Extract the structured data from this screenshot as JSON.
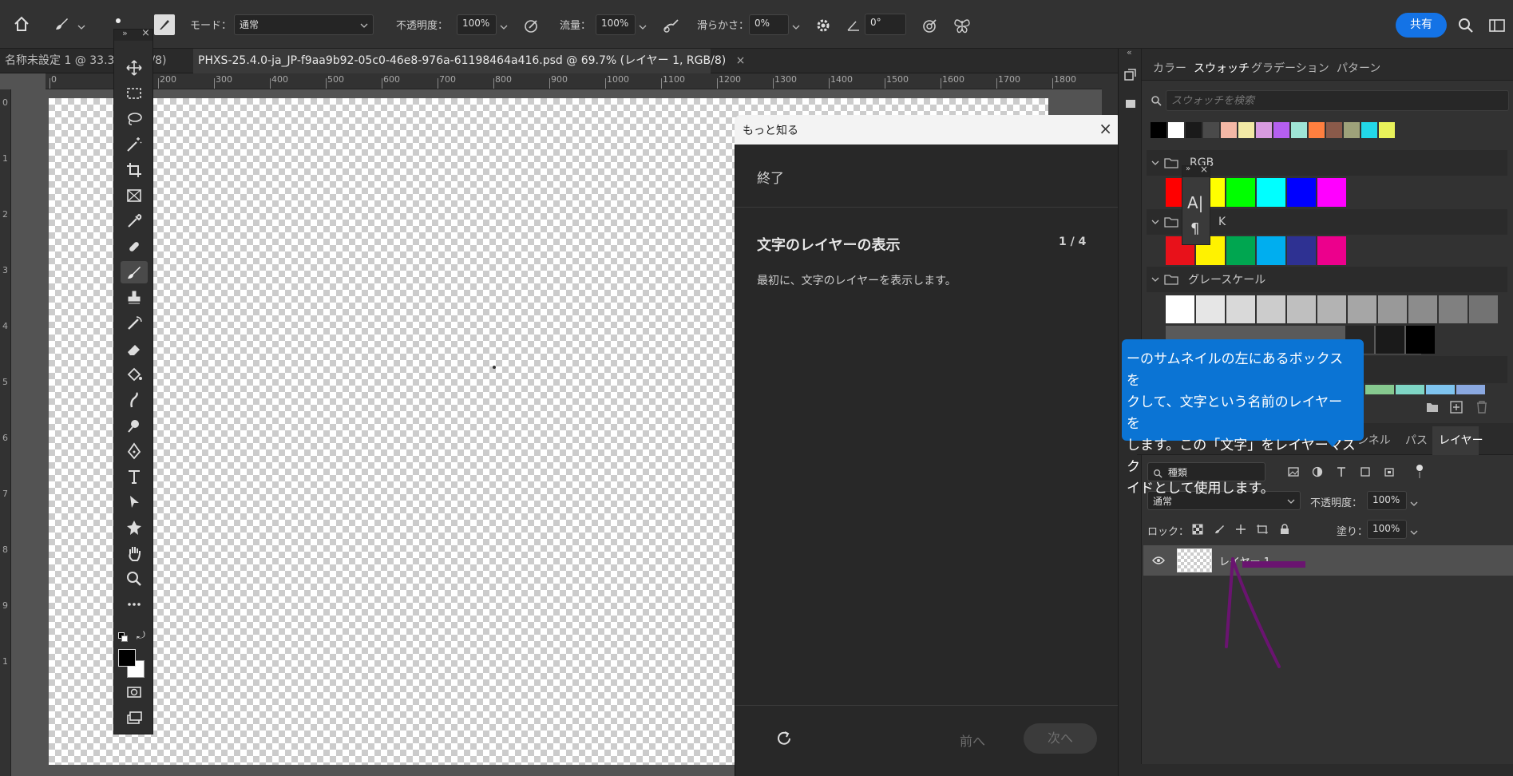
{
  "optionsBar": {
    "mode_label": "モード：",
    "mode_value": "通常",
    "opacity_label": "不透明度：",
    "opacity_value": "100%",
    "flow_label": "流量：",
    "flow_value": "100%",
    "smoothing_label": "滑らかさ：",
    "smoothing_value": "0%",
    "angle_value": "0°",
    "share_label": "共有"
  },
  "tabs": [
    {
      "label": "名称未設定 1 @ 33.3",
      "suffix": "/8)"
    },
    {
      "label": "PHXS-25.4.0-ja_JP-f9aa9b92-05c0-46e8-976a-61198464a416.psd @ 69.7% (レイヤー 1, RGB/8)",
      "close": "×"
    }
  ],
  "ruler": {
    "h_labels": [
      "0",
      "200",
      "300",
      "400",
      "500",
      "600",
      "700",
      "800",
      "900",
      "1000",
      "1100",
      "1200",
      "1300",
      "1400",
      "1500",
      "1600",
      "1700",
      "1800"
    ],
    "v_labels": [
      "0",
      "1",
      "2",
      "3",
      "4",
      "5",
      "6",
      "7",
      "8",
      "9",
      "1"
    ]
  },
  "learn": {
    "header": "もっと知る",
    "close": "×",
    "end_label": "終了",
    "step_title": "文字のレイヤーの表示",
    "step_counter": "1 / 4",
    "step_text": "最初に、文字のレイヤーを表示します。",
    "prev_label": "前へ",
    "next_label": "次へ"
  },
  "swatchPanel": {
    "tabs": [
      "カラー",
      "スウォッチ",
      "グラデーション",
      "パターン"
    ],
    "active_tab": "スウォッチ",
    "search_placeholder": "スウォッチを検索",
    "recent_colors": [
      "#000000",
      "#ffffff",
      "#1a1a1a",
      "#4a4a4a",
      "#f4b8a6",
      "#f2e9a5",
      "#d89be0",
      "#b55ff0",
      "#9fe5d6",
      "#ff7f3f",
      "#8a5a4a",
      "#9ea27a",
      "#22d8e8",
      "#e8f25a"
    ],
    "groups": {
      "rgb": {
        "name": "RGB",
        "colors": [
          "#ff0000",
          "#ffff00",
          "#00ff00",
          "#00ffff",
          "#0000ff",
          "#ff00ff"
        ]
      },
      "cmyk": {
        "name": "K",
        "colors": [
          "#e8111a",
          "#fff200",
          "#00a650",
          "#00aeef",
          "#2e3192",
          "#ec008c"
        ]
      },
      "gray": {
        "name": "グレースケール",
        "colors": [
          "#ffffff",
          "#e6e6e6",
          "#d9d9d9",
          "#cccccc",
          "#bfbfbf",
          "#b3b3b3",
          "#a6a6a6",
          "#999999",
          "#8c8c8c",
          "#808080",
          "#737373"
        ]
      }
    }
  },
  "floating_type_panel": {
    "char_icon": "A|",
    "para_icon": "¶"
  },
  "tooltip": {
    "lines": [
      "ーのサムネイルの左にあるボックスを",
      "クして、文字という名前のレイヤーを",
      "します。この「文字」をレイヤーマスク",
      "イドとして使用します。"
    ]
  },
  "layersPanel": {
    "tabs": [
      "ンネル",
      "パス",
      "レイヤー"
    ],
    "filter_value": "種類",
    "blend_value": "通常",
    "opacity_label": "不透明度：",
    "opacity_value": "100%",
    "lock_label": "ロック：",
    "fill_label": "塗り：",
    "fill_value": "100%",
    "layer_name": "レイヤー 1"
  }
}
